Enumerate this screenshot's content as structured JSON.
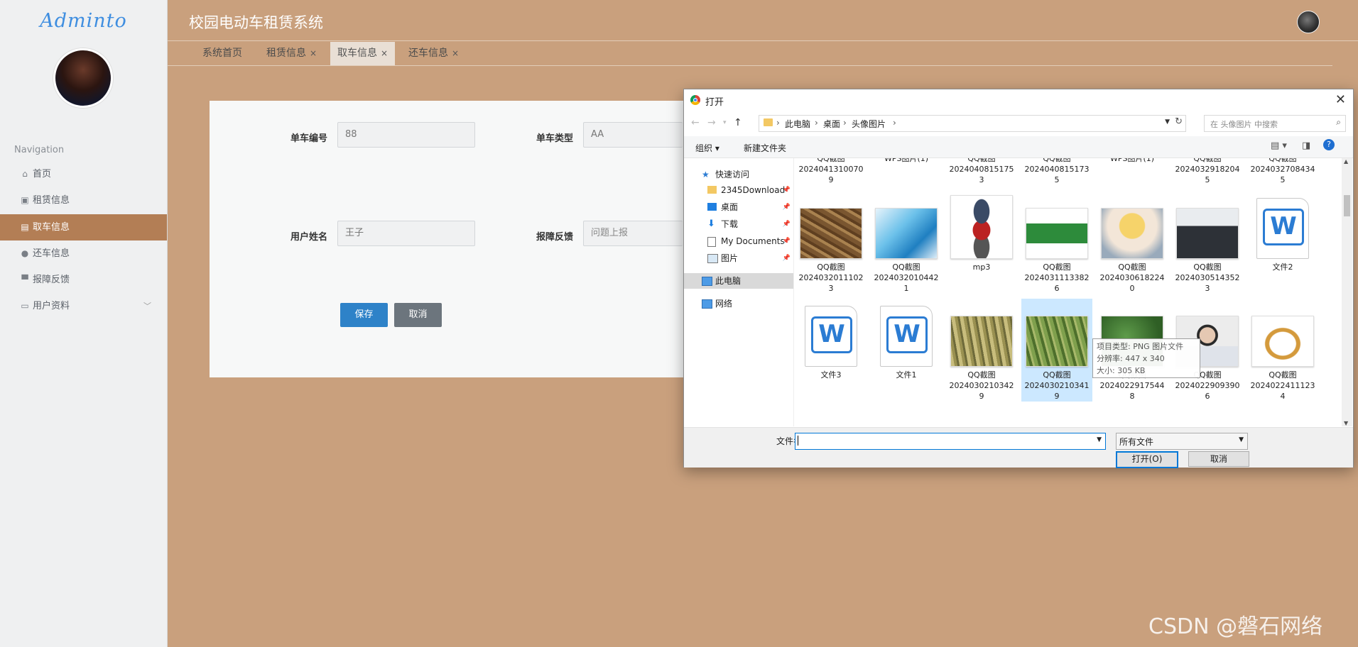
{
  "sidebar": {
    "logo": "Adminto",
    "nav_title": "Navigation",
    "items": [
      {
        "label": "首页",
        "icon": "home-icon",
        "glyph": "⌂"
      },
      {
        "label": "租赁信息",
        "icon": "briefcase-icon",
        "glyph": "▣"
      },
      {
        "label": "取车信息",
        "icon": "clipboard-icon",
        "glyph": "▤"
      },
      {
        "label": "还车信息",
        "icon": "map-pin-icon",
        "glyph": "●"
      },
      {
        "label": "报障反馈",
        "icon": "monitor-icon",
        "glyph": "▀"
      },
      {
        "label": "用户资料",
        "icon": "id-card-icon",
        "glyph": "▭",
        "chevron": "﹀"
      }
    ]
  },
  "header": {
    "title": "校园电动车租赁系统"
  },
  "tabs": [
    {
      "label": "系统首页",
      "close": ""
    },
    {
      "label": "租赁信息",
      "close": "×"
    },
    {
      "label": "取车信息",
      "close": "×"
    },
    {
      "label": "还车信息",
      "close": "×"
    }
  ],
  "form": {
    "bike_no_label": "单车编号",
    "bike_no_value": "88",
    "bike_type_label": "单车类型",
    "bike_type_value": "AA",
    "username_label": "用户姓名",
    "username_value": "王子",
    "feedback_label": "报障反馈",
    "feedback_placeholder": "问题上报",
    "save_label": "保存",
    "cancel_label": "取消"
  },
  "dialog": {
    "title": "打开",
    "close": "✕",
    "breadcrumbs": [
      "此电脑",
      "桌面",
      "头像图片"
    ],
    "search_placeholder": "在 头像图片 中搜索",
    "organize_label": "组织 ▾",
    "new_folder_label": "新建文件夹",
    "tree": [
      {
        "label": "快速访问",
        "icon": "star-icon"
      },
      {
        "label": "2345Download",
        "icon": "folder-icon",
        "pin": true
      },
      {
        "label": "桌面",
        "icon": "desktop-icon",
        "pin": true
      },
      {
        "label": "下载",
        "icon": "download-icon",
        "pin": true
      },
      {
        "label": "My Documents",
        "icon": "documents-icon",
        "pin": true
      },
      {
        "label": "图片",
        "icon": "pictures-icon",
        "pin": true
      },
      {
        "label": "此电脑",
        "icon": "computer-icon"
      },
      {
        "label": "网络",
        "icon": "network-icon"
      }
    ],
    "row0": [
      {
        "l1": "QQ截图",
        "l2": "20240413100709"
      },
      {
        "l1": "WPS图片(1)",
        "l2": ""
      },
      {
        "l1": "QQ截图",
        "l2": "20240408151753"
      },
      {
        "l1": "QQ截图",
        "l2": "20240408151735"
      },
      {
        "l1": "WPS图片(1)",
        "l2": ""
      },
      {
        "l1": "QQ截图",
        "l2": "20240329182045"
      },
      {
        "l1": "QQ截图",
        "l2": "20240327084345"
      }
    ],
    "row1": [
      {
        "l1": "QQ截图",
        "l2": "20240320111023",
        "thumb": "food",
        "color": "#8b6a3e"
      },
      {
        "l1": "QQ截图",
        "l2": "20240320104421",
        "thumb": "device",
        "color": "#3aa3d9"
      },
      {
        "l1": "mp3",
        "l2": "",
        "thumb": "mp3",
        "color": "#c03030"
      },
      {
        "l1": "QQ截图",
        "l2": "20240311133826",
        "thumb": "plate",
        "color": "#2e8b3a"
      },
      {
        "l1": "QQ截图",
        "l2": "20240306182240",
        "thumb": "anime",
        "color": "#e8c34a"
      },
      {
        "l1": "QQ截图",
        "l2": "20240305143523",
        "thumb": "road",
        "color": "#3b3f46"
      },
      {
        "l1": "文件2",
        "l2": "",
        "thumb": "word",
        "color": "#2b7cd3"
      }
    ],
    "row2": [
      {
        "l1": "文件3",
        "l2": "",
        "thumb": "word",
        "color": "#2b7cd3"
      },
      {
        "l1": "文件1",
        "l2": "",
        "thumb": "word",
        "color": "#2b7cd3"
      },
      {
        "l1": "QQ截图",
        "l2": "20240302103429",
        "thumb": "wheat",
        "color": "#b9ad6a"
      },
      {
        "l1": "QQ截图",
        "l2": "20240302103419",
        "thumb": "wheat2",
        "color": "#6f8f44"
      },
      {
        "l1": "QQ截图",
        "l2": "20240229175448",
        "thumb": "green",
        "color": "#3f7a35"
      },
      {
        "l1": "QQ截图",
        "l2": "20240229093906",
        "thumb": "person",
        "color": "#c9c9c9"
      },
      {
        "l1": "QQ截图",
        "l2": "20240224111234",
        "thumb": "ring",
        "color": "#c9903a"
      }
    ],
    "tooltip": [
      "项目类型: PNG 图片文件",
      "分辨率: 447 x 340",
      "大小: 305 KB"
    ],
    "filename_label": "文件名(N):",
    "filetype_value": "所有文件",
    "open_label": "打开(O)",
    "cancel_label": "取消"
  },
  "watermark": "CSDN @磐石网络"
}
